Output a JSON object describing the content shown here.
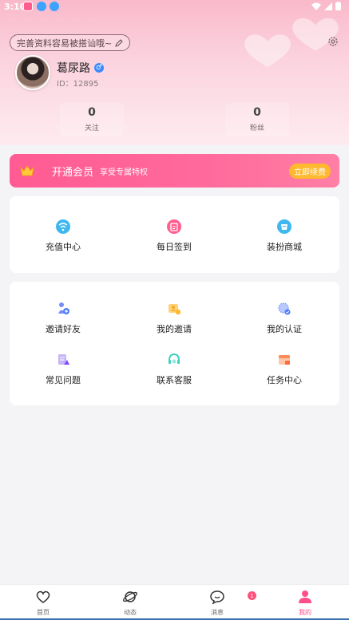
{
  "status_bar": {
    "time": "3:10"
  },
  "profile": {
    "hint": "完善资料容易被搭讪哦~",
    "name": "葛尿路",
    "gender_symbol": "♂",
    "id_text": "ID：12895",
    "stats": [
      {
        "value": "0",
        "label": "关注"
      },
      {
        "value": "0",
        "label": "粉丝"
      }
    ]
  },
  "vip": {
    "title": "开通会员",
    "subtitle": "享受专属特权",
    "button": "立即续费",
    "accent": "#ff5b93",
    "button_color": "#ffb92e"
  },
  "quick_actions": [
    {
      "label": "充值中心",
      "icon": "recharge-icon",
      "color": "#3fb8f0"
    },
    {
      "label": "每日签到",
      "icon": "checkin-icon",
      "color": "#ff5e8e"
    },
    {
      "label": "装扮商城",
      "icon": "store-icon",
      "color": "#3fb8f0"
    }
  ],
  "services": [
    {
      "label": "邀请好友",
      "icon": "invite-friends-icon"
    },
    {
      "label": "我的邀请",
      "icon": "my-invites-icon"
    },
    {
      "label": "我的认证",
      "icon": "verification-icon"
    },
    {
      "label": "常见问题",
      "icon": "faq-icon"
    },
    {
      "label": "联系客服",
      "icon": "customer-service-icon"
    },
    {
      "label": "任务中心",
      "icon": "task-center-icon"
    }
  ],
  "bottom_nav": {
    "items": [
      {
        "label": "首页",
        "icon": "home-heart-icon"
      },
      {
        "label": "动态",
        "icon": "planet-icon"
      },
      {
        "label": "消息",
        "icon": "chat-bubble-icon"
      },
      {
        "label": "我的",
        "icon": "person-icon"
      }
    ],
    "message_badge": "1",
    "active_color": "#ff4f8b"
  }
}
